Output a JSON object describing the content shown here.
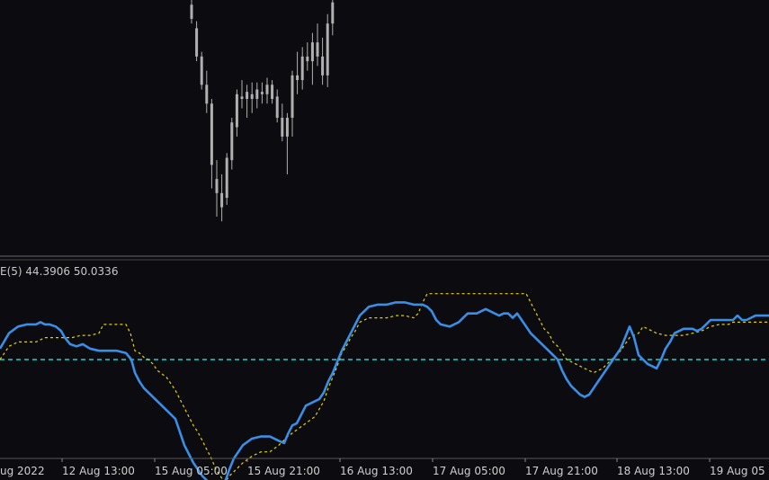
{
  "chart_data": [
    {
      "type": "candlestick",
      "title": "",
      "colors": {
        "background": "#0b0b10",
        "candle": "#b0b0b0"
      },
      "candles": [
        {
          "o": 0.92,
          "h": 1.0,
          "l": 0.9,
          "c": 0.98
        },
        {
          "o": 0.88,
          "h": 0.91,
          "l": 0.74,
          "c": 0.76
        },
        {
          "o": 0.76,
          "h": 0.78,
          "l": 0.62,
          "c": 0.64
        },
        {
          "o": 0.64,
          "h": 0.7,
          "l": 0.52,
          "c": 0.56
        },
        {
          "o": 0.56,
          "h": 0.58,
          "l": 0.2,
          "c": 0.3
        },
        {
          "o": 0.24,
          "h": 0.32,
          "l": 0.08,
          "c": 0.18
        },
        {
          "o": 0.18,
          "h": 0.26,
          "l": 0.06,
          "c": 0.12
        },
        {
          "o": 0.16,
          "h": 0.35,
          "l": 0.13,
          "c": 0.33
        },
        {
          "o": 0.32,
          "h": 0.5,
          "l": 0.28,
          "c": 0.48
        },
        {
          "o": 0.46,
          "h": 0.62,
          "l": 0.42,
          "c": 0.6
        },
        {
          "o": 0.59,
          "h": 0.66,
          "l": 0.54,
          "c": 0.58
        },
        {
          "o": 0.58,
          "h": 0.64,
          "l": 0.5,
          "c": 0.61
        },
        {
          "o": 0.6,
          "h": 0.65,
          "l": 0.52,
          "c": 0.58
        },
        {
          "o": 0.58,
          "h": 0.65,
          "l": 0.54,
          "c": 0.62
        },
        {
          "o": 0.61,
          "h": 0.65,
          "l": 0.56,
          "c": 0.6
        },
        {
          "o": 0.6,
          "h": 0.67,
          "l": 0.56,
          "c": 0.64
        },
        {
          "o": 0.64,
          "h": 0.66,
          "l": 0.56,
          "c": 0.58
        },
        {
          "o": 0.59,
          "h": 0.62,
          "l": 0.48,
          "c": 0.5
        },
        {
          "o": 0.5,
          "h": 0.56,
          "l": 0.4,
          "c": 0.42
        },
        {
          "o": 0.42,
          "h": 0.52,
          "l": 0.26,
          "c": 0.5
        },
        {
          "o": 0.5,
          "h": 0.7,
          "l": 0.42,
          "c": 0.68
        },
        {
          "o": 0.68,
          "h": 0.78,
          "l": 0.6,
          "c": 0.66
        },
        {
          "o": 0.66,
          "h": 0.8,
          "l": 0.62,
          "c": 0.76
        },
        {
          "o": 0.76,
          "h": 0.82,
          "l": 0.7,
          "c": 0.74
        },
        {
          "o": 0.74,
          "h": 0.86,
          "l": 0.64,
          "c": 0.82
        },
        {
          "o": 0.82,
          "h": 0.9,
          "l": 0.72,
          "c": 0.76
        },
        {
          "o": 0.76,
          "h": 0.84,
          "l": 0.64,
          "c": 0.68
        },
        {
          "o": 0.68,
          "h": 0.94,
          "l": 0.63,
          "c": 0.9
        },
        {
          "o": 0.9,
          "h": 1.0,
          "l": 0.85,
          "c": 0.99
        }
      ]
    },
    {
      "type": "line",
      "indicator_label": "E(5) 44.3906 50.0336",
      "level": 40,
      "ylim": [
        -5,
        85
      ],
      "colors": {
        "main": "#3a8ee6",
        "signal": "#e6d200",
        "level": "#19d3d3"
      },
      "x_tick_labels": [
        "ug 2022",
        "12 Aug 13:00",
        "15 Aug 05:00",
        "15 Aug 21:00",
        "16 Aug 13:00",
        "17 Aug 05:00",
        "17 Aug 21:00",
        "18 Aug 13:00",
        "19 Aug 05"
      ],
      "series": [
        {
          "style": "solid",
          "x": [
            0,
            10,
            20,
            30,
            40,
            45,
            50,
            55,
            62,
            68,
            72,
            78,
            85,
            92,
            100,
            110,
            120,
            130,
            140,
            146,
            150,
            155,
            160,
            165,
            175,
            185,
            195,
            200,
            205,
            210,
            215,
            220,
            225,
            230,
            235,
            240,
            243,
            246,
            250,
            255,
            260,
            270,
            280,
            290,
            300,
            310,
            316,
            320,
            325,
            330,
            335,
            340,
            350,
            355,
            360,
            365,
            370,
            375,
            380,
            385,
            390,
            395,
            400,
            410,
            420,
            430,
            440,
            450,
            460,
            465,
            470,
            475,
            480,
            485,
            490,
            500,
            510,
            515,
            520,
            530,
            540,
            550,
            555,
            560,
            565,
            570,
            575,
            580,
            585,
            590,
            595,
            600,
            605,
            610,
            615,
            620,
            625,
            630,
            635,
            640,
            645,
            650,
            655,
            660,
            665,
            670,
            675,
            680,
            685,
            690,
            695,
            700,
            705,
            710,
            715,
            720,
            725,
            730,
            735,
            740,
            745,
            750,
            760,
            770,
            775,
            780,
            785,
            790,
            800,
            810,
            815,
            820,
            825,
            830,
            840,
            855
          ],
          "y": [
            45,
            52,
            55,
            56,
            56,
            57,
            56,
            56,
            55,
            53,
            50,
            47,
            46,
            47,
            45,
            44,
            44,
            44,
            43,
            40,
            34,
            30,
            27,
            25,
            21,
            17,
            13,
            7,
            1,
            -3,
            -7,
            -10,
            -13,
            -15,
            -17,
            -20,
            -21,
            -19,
            -16,
            -10,
            -5,
            1,
            4,
            5,
            5,
            3,
            2,
            6,
            10,
            11,
            15,
            19,
            21,
            22,
            25,
            30,
            34,
            39,
            44,
            48,
            52,
            56,
            60,
            64,
            65,
            65,
            66,
            66,
            65,
            65,
            65,
            64,
            62,
            58,
            56,
            55,
            57,
            59,
            61,
            61,
            63,
            61,
            60,
            61,
            61,
            59,
            61,
            58,
            55,
            52,
            50,
            48,
            46,
            44,
            42,
            40,
            35,
            31,
            28,
            26,
            24,
            23,
            24,
            27,
            30,
            33,
            36,
            39,
            42,
            45,
            50,
            55,
            50,
            42,
            40,
            38,
            37,
            36,
            40,
            45,
            48,
            52,
            54,
            54,
            53,
            54,
            56,
            58,
            58,
            58,
            58,
            60,
            58,
            58,
            60,
            60
          ],
          "name": ""
        },
        {
          "style": "dotted",
          "x": [
            0,
            10,
            20,
            30,
            40,
            50,
            60,
            70,
            80,
            90,
            100,
            110,
            115,
            120,
            130,
            140,
            145,
            150,
            155,
            160,
            165,
            170,
            175,
            185,
            195,
            200,
            205,
            210,
            215,
            220,
            225,
            230,
            235,
            240,
            245,
            250,
            255,
            260,
            270,
            280,
            290,
            300,
            310,
            320,
            330,
            340,
            350,
            360,
            365,
            370,
            375,
            380,
            385,
            390,
            395,
            400,
            410,
            420,
            430,
            440,
            450,
            460,
            465,
            470,
            475,
            480,
            490,
            500,
            510,
            520,
            530,
            540,
            550,
            560,
            570,
            575,
            580,
            585,
            590,
            595,
            600,
            605,
            610,
            615,
            620,
            625,
            630,
            640,
            650,
            660,
            670,
            680,
            690,
            700,
            710,
            715,
            720,
            730,
            740,
            750,
            760,
            770,
            780,
            790,
            800,
            810,
            815,
            820,
            830,
            840,
            855
          ],
          "y": [
            40,
            46,
            48,
            48,
            48,
            50,
            50,
            50,
            50,
            51,
            51,
            52,
            56,
            56,
            56,
            56,
            52,
            44,
            43,
            41,
            40,
            38,
            35,
            32,
            26,
            22,
            18,
            14,
            10,
            7,
            3,
            -1,
            -5,
            -10,
            -13,
            -16,
            -13,
            -11,
            -7,
            -4,
            -2,
            -2,
            1,
            5,
            8,
            11,
            14,
            21,
            27,
            32,
            37,
            43,
            46,
            50,
            53,
            57,
            59,
            59,
            59,
            60,
            60,
            59,
            61,
            66,
            70,
            70,
            70,
            70,
            70,
            70,
            70,
            70,
            70,
            70,
            70,
            70,
            70,
            70,
            66,
            62,
            58,
            54,
            52,
            48,
            46,
            43,
            40,
            38,
            36,
            34,
            36,
            40,
            44,
            50,
            52,
            55,
            54,
            52,
            51,
            51,
            51,
            52,
            53,
            55,
            56,
            56,
            57,
            57,
            57,
            57,
            57
          ],
          "name": ""
        }
      ]
    }
  ]
}
